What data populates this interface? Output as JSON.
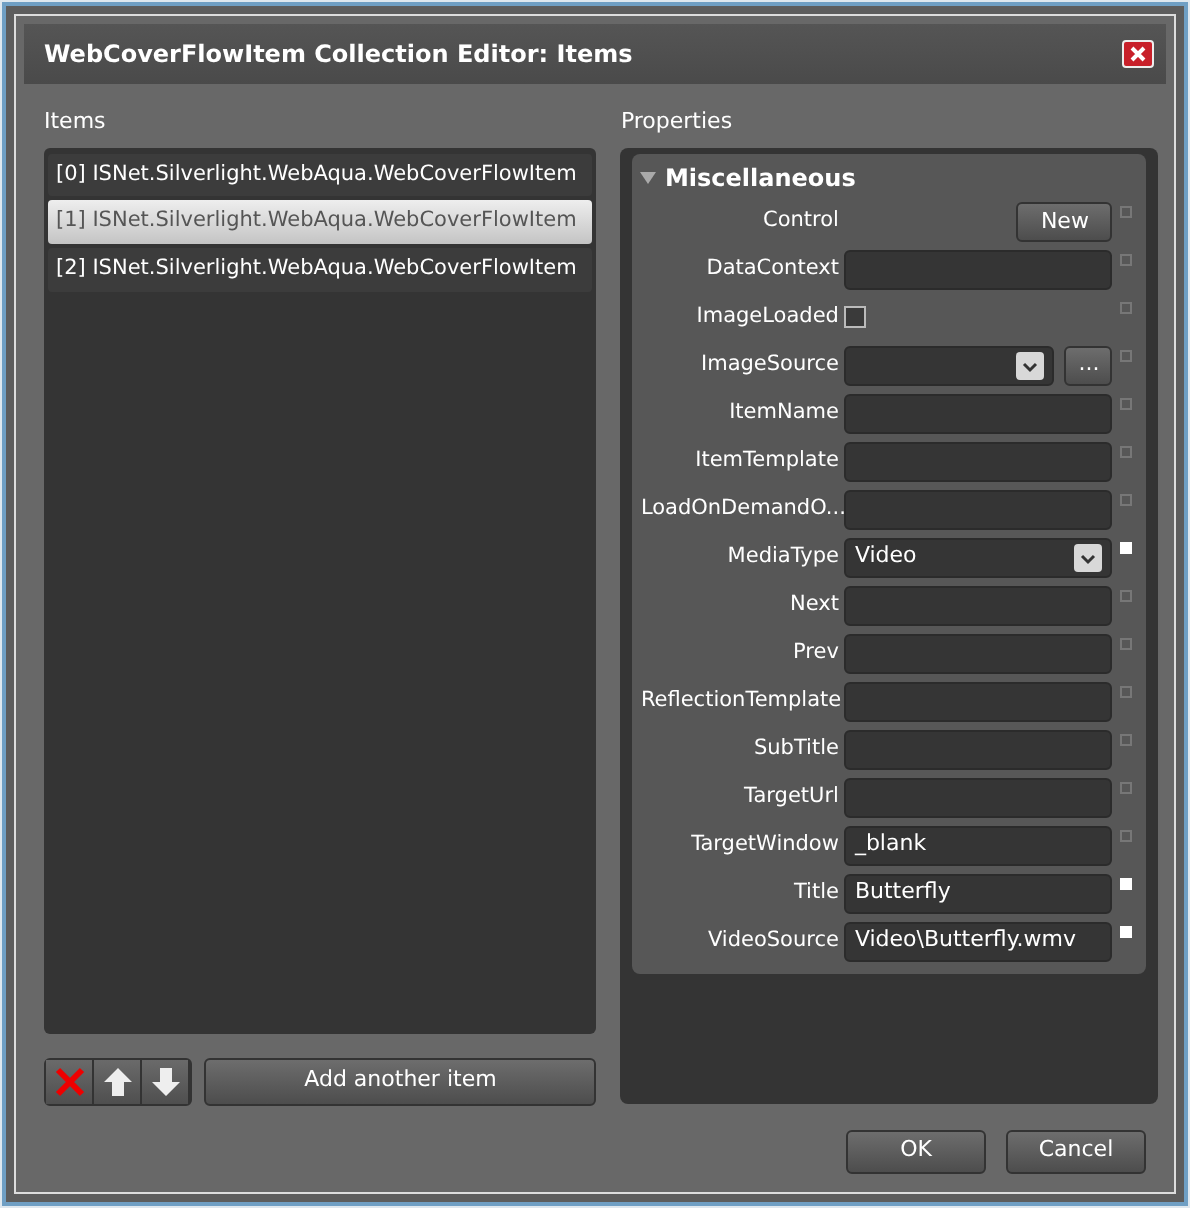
{
  "window": {
    "title": "WebCoverFlowItem Collection Editor: Items"
  },
  "items": {
    "label": "Items",
    "list": [
      {
        "text": "[0] ISNet.Silverlight.WebAqua.WebCoverFlowItem",
        "selected": false
      },
      {
        "text": "[1] ISNet.Silverlight.WebAqua.WebCoverFlowItem",
        "selected": true
      },
      {
        "text": "[2] ISNet.Silverlight.WebAqua.WebCoverFlowItem",
        "selected": false
      }
    ],
    "add_button": "Add another item"
  },
  "properties": {
    "label": "Properties",
    "category": {
      "title": "Miscellaneous",
      "expanded": true
    },
    "rows": [
      {
        "name": "Control",
        "kind": "button",
        "button": "New",
        "value_set": false
      },
      {
        "name": "DataContext",
        "kind": "text",
        "value_set": false
      },
      {
        "name": "ImageLoaded",
        "kind": "checkbox",
        "checked": false,
        "value_set": false
      },
      {
        "name": "ImageSource",
        "kind": "combo",
        "button": "...",
        "value_set": false
      },
      {
        "name": "ItemName",
        "kind": "text",
        "value_set": false
      },
      {
        "name": "ItemTemplate",
        "kind": "text",
        "value_set": false
      },
      {
        "name": "LoadOnDemandO...",
        "kind": "text",
        "value_set": false
      },
      {
        "name": "MediaType",
        "kind": "select",
        "value": "Video",
        "value_set": true
      },
      {
        "name": "Next",
        "kind": "text",
        "value_set": false
      },
      {
        "name": "Prev",
        "kind": "text",
        "value_set": false
      },
      {
        "name": "ReflectionTemplate",
        "kind": "text",
        "value_set": false
      },
      {
        "name": "SubTitle",
        "kind": "text",
        "value_set": false
      },
      {
        "name": "TargetUrl",
        "kind": "text",
        "value_set": false
      },
      {
        "name": "TargetWindow",
        "kind": "text",
        "value": "_blank",
        "value_set": false
      },
      {
        "name": "Title",
        "kind": "text",
        "value": "Butterfly",
        "value_set": true
      },
      {
        "name": "VideoSource",
        "kind": "text",
        "value": "Video\\Butterfly.wmv",
        "value_set": true
      }
    ]
  },
  "footer": {
    "buttons": [
      "OK",
      "Cancel"
    ]
  }
}
